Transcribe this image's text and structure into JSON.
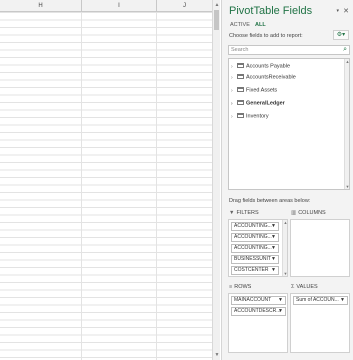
{
  "sheet": {
    "columns": [
      "H",
      "I",
      "J"
    ]
  },
  "pivot": {
    "title": "PivotTable Fields",
    "tabs": {
      "active": "ACTIVE",
      "all": "ALL"
    },
    "choose_label": "Choose fields to add to report:",
    "search_placeholder": "Search",
    "fields": [
      {
        "name": "Accounts Payable",
        "bold": false
      },
      {
        "name": "AccountsReceivable",
        "bold": false
      },
      {
        "name": "Fixed Assets",
        "bold": false
      },
      {
        "name": "GeneralLedger",
        "bold": true
      },
      {
        "name": "Inventory",
        "bold": false
      }
    ],
    "drag_label": "Drag fields between areas below:",
    "areas": {
      "filters": {
        "label": "FILTERS",
        "items": [
          "ACCOUNTING...",
          "ACCOUNTING...",
          "ACCOUNTING...",
          "BUSINESSUNIT",
          "COSTCENTER"
        ]
      },
      "columns": {
        "label": "COLUMNS",
        "items": []
      },
      "rows": {
        "label": "ROWS",
        "items": [
          "MAINACCOUNT",
          "ACCOUNTDESCR..."
        ]
      },
      "values": {
        "label": "VALUES",
        "items": [
          "Sum of ACCOUN..."
        ]
      }
    }
  },
  "colors": {
    "accent": "#217346",
    "panel_bg": "#f3f3f3"
  }
}
